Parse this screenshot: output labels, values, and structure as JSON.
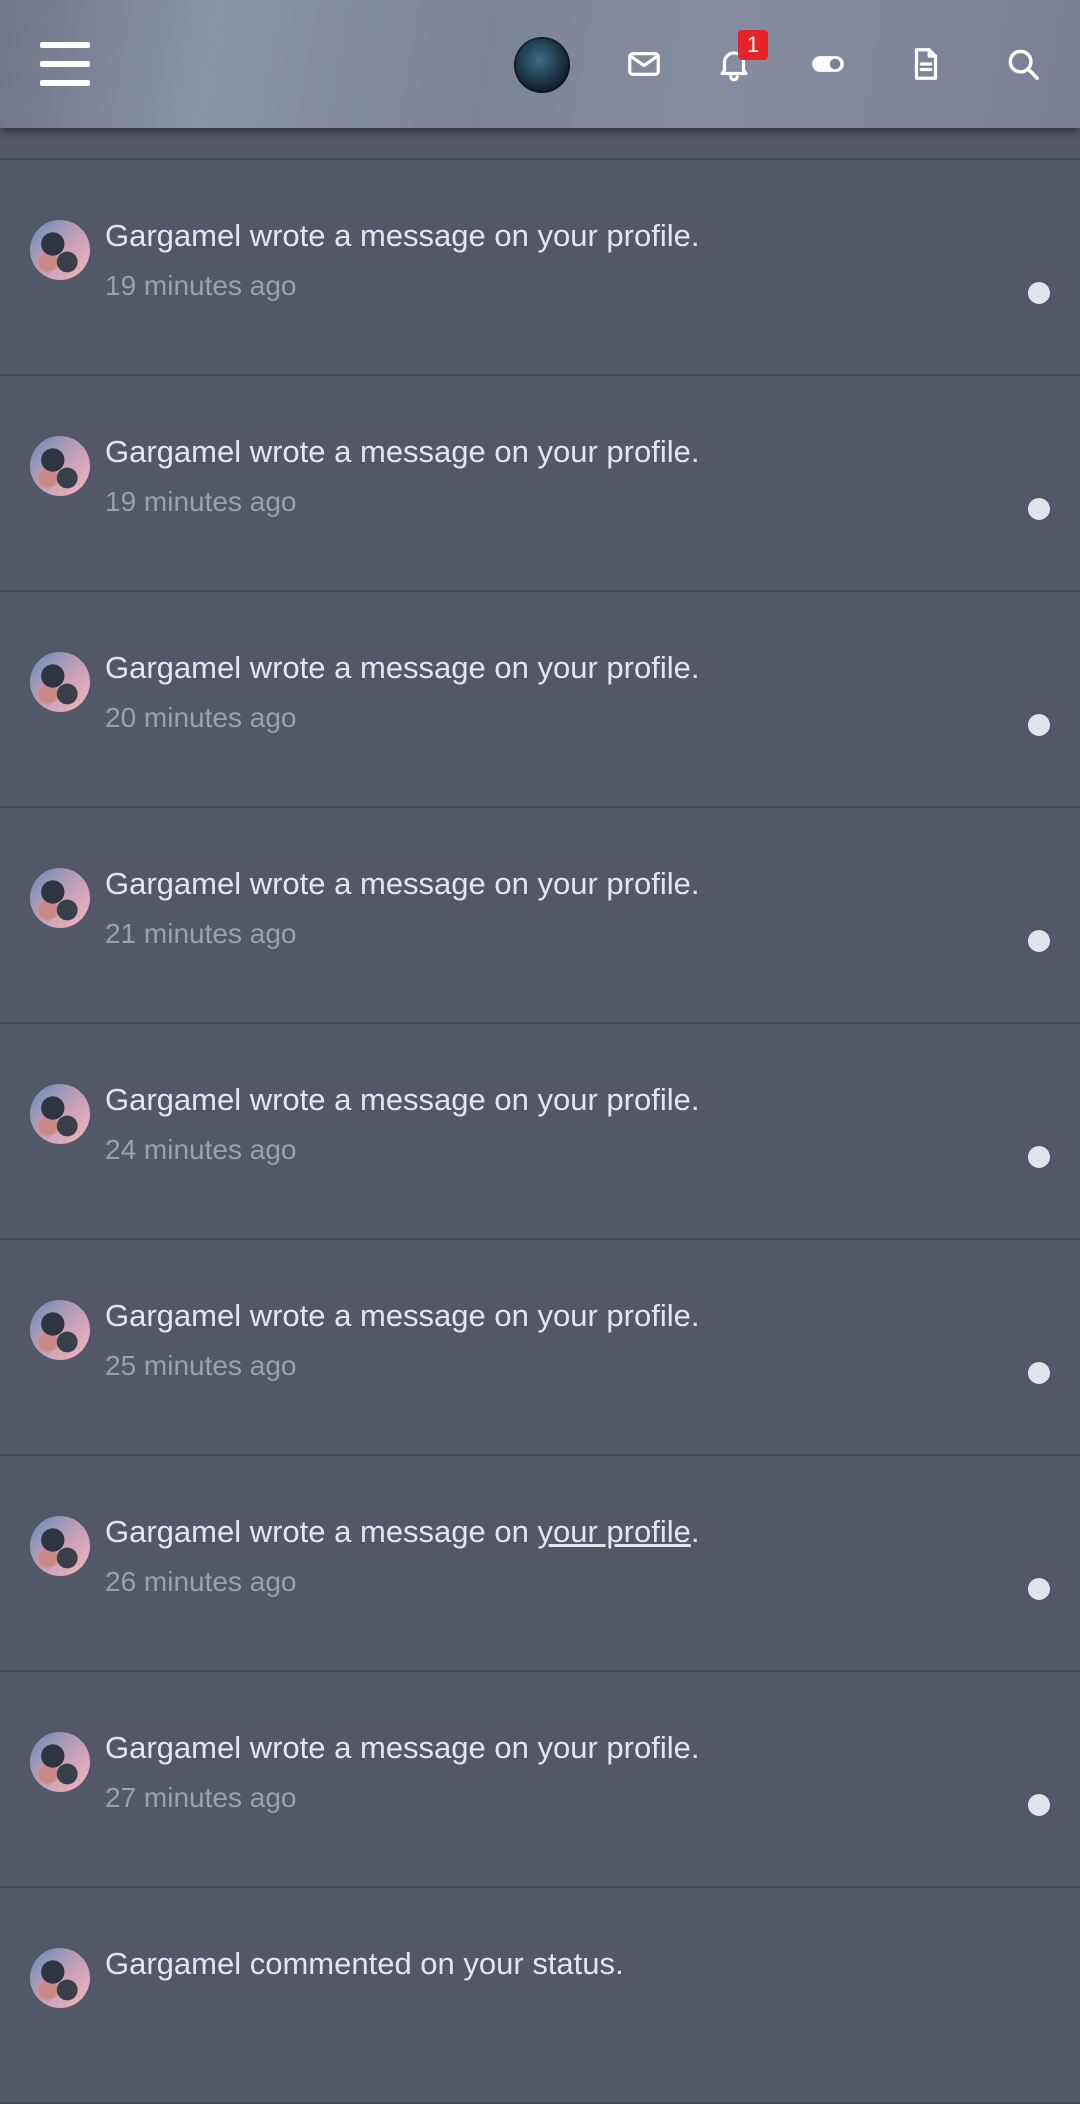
{
  "header": {
    "icons": [
      "menu-icon",
      "avatar",
      "mail-icon",
      "bell-icon",
      "toggle-icon",
      "document-icon",
      "search-icon"
    ],
    "notification_count": "1",
    "badge_color": "#e5242a"
  },
  "notifications": [
    {
      "actor": "Gargamel",
      "action": " wrote a message on ",
      "target": "your profile",
      "end": ".",
      "time": "19 minutes ago"
    },
    {
      "actor": "Gargamel",
      "action": " wrote a message on ",
      "target": "your profile",
      "end": ".",
      "time": "19 minutes ago"
    },
    {
      "actor": "Gargamel",
      "action": " wrote a message on ",
      "target": "your profile",
      "end": ".",
      "time": "20 minutes ago"
    },
    {
      "actor": "Gargamel",
      "action": " wrote a message on ",
      "target": "your profile",
      "end": ".",
      "time": "21 minutes ago"
    },
    {
      "actor": "Gargamel",
      "action": " wrote a message on ",
      "target": "your profile",
      "end": ".",
      "time": "24 minutes ago"
    },
    {
      "actor": "Gargamel",
      "action": " wrote a message on ",
      "target": "your profile",
      "end": ".",
      "time": "25 minutes ago"
    },
    {
      "actor": "Gargamel",
      "action": " wrote a message on ",
      "target": "your profile",
      "end": ".",
      "time": "26 minutes ago"
    },
    {
      "actor": "Gargamel",
      "action": " wrote a message on ",
      "target": "your profile",
      "end": ".",
      "time": "27 minutes ago"
    },
    {
      "actor": "Gargamel",
      "action": " commented on ",
      "target": "your status",
      "end": ".",
      "time": ""
    }
  ],
  "colors": {
    "background": "#525868",
    "text": "#e4e6ec",
    "muted": "#9aa0ae",
    "unread_dot": "#e1e4ea"
  }
}
